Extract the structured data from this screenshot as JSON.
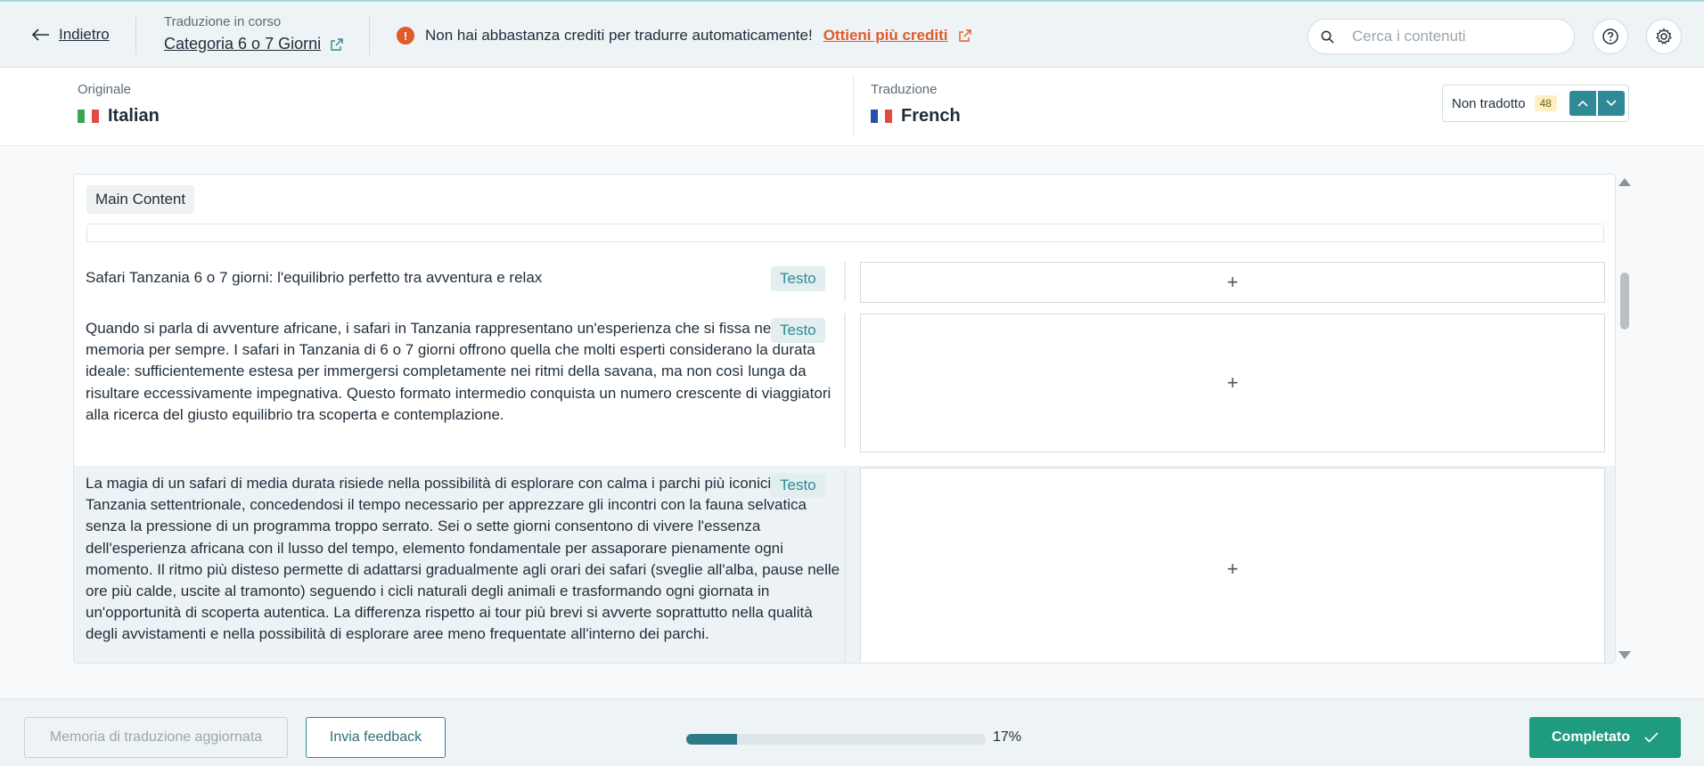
{
  "header": {
    "back_label": "Indietro",
    "subtitle": "Traduzione in corso",
    "title": "Categoria 6 o 7 Giorni",
    "warning_text": "Non hai abbastanza crediti per tradurre automaticamente!",
    "warning_link": "Ottieni più crediti",
    "search_placeholder": "Cerca i contenuti",
    "icons": {
      "back": "arrow-left-icon",
      "external": "external-link-icon",
      "warning": "alert-icon",
      "search": "search-icon",
      "help": "help-icon",
      "settings": "gear-icon"
    },
    "colors": {
      "accent": "#2e8a96",
      "warning": "#e05a2a"
    }
  },
  "languages": {
    "original_caption": "Originale",
    "original_name": "Italian",
    "translation_caption": "Traduzione",
    "translation_name": "French",
    "filter_label": "Non tradotto",
    "filter_count": "48"
  },
  "content": {
    "section_label": "Main Content",
    "rows": [
      {
        "source": "Safari Tanzania 6 o 7 giorni: l'equilibrio perfetto tra avventura e relax",
        "tag": "Testo",
        "target_placeholder": "+"
      },
      {
        "source": "Quando si parla di avventure africane, i safari in Tanzania rappresentano un'esperienza che si fissa nella memoria per sempre. I safari in Tanzania di 6 o 7 giorni offrono quella che molti esperti considerano la durata ideale: sufficientemente estesa per immergersi completamente nei ritmi della savana, ma non così lunga da risultare eccessivamente impegnativa. Questo formato intermedio conquista un numero crescente di viaggiatori alla ricerca del giusto equilibrio tra scoperta e contemplazione.",
        "tag": "Testo",
        "target_placeholder": "+"
      },
      {
        "source": "La magia di un safari di media durata risiede nella possibilità di esplorare con calma i parchi più iconici della Tanzania settentrionale, concedendosi il tempo necessario per apprezzare gli incontri con la fauna selvatica senza la pressione di un programma troppo serrato. Sei o sette giorni consentono di vivere l'essenza dell'esperienza africana con il lusso del tempo, elemento fondamentale per assaporare pienamente ogni momento. Il ritmo più disteso permette di adattarsi gradualmente agli orari dei safari (sveglie all'alba, pause nelle ore più calde, uscite al tramonto) seguendo i cicli naturali degli animali e trasformando ogni giornata in un'opportunità di scoperta autentica. La differenza rispetto ai tour più brevi si avverte soprattutto nella qualità degli avvistamenti e nella possibilità di esplorare aree meno frequentate all'interno dei parchi.",
        "tag": "Testo",
        "target_placeholder": "+"
      }
    ]
  },
  "footer": {
    "memory_label": "Memoria di traduzione aggiornata",
    "feedback_label": "Invia feedback",
    "progress_value": 0.17,
    "progress_label": "17%",
    "done_label": "Completato"
  }
}
